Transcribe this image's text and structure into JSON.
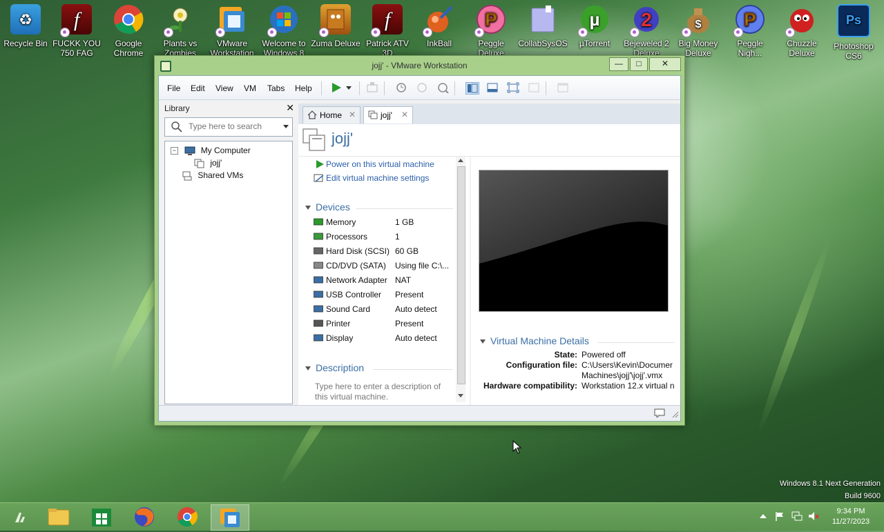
{
  "desktop": {
    "icons": [
      {
        "label": "Recycle Bin"
      },
      {
        "label": "FUCKK YOU 750 FAG"
      },
      {
        "label": "Google Chrome"
      },
      {
        "label": "Plants vs Zombies"
      },
      {
        "label": "VMware Workstation"
      },
      {
        "label": "Welcome to Windows 8"
      },
      {
        "label": "Zuma Deluxe"
      },
      {
        "label": "Patrick ATV 3D"
      },
      {
        "label": "InkBall"
      },
      {
        "label": "Peggle Deluxe"
      },
      {
        "label": "CollabSysOS"
      },
      {
        "label": "µTorrent"
      },
      {
        "label": "Bejeweled 2 Deluxe"
      },
      {
        "label": "Big Money Deluxe"
      },
      {
        "label": "Peggle Nigh..."
      },
      {
        "label": "Chuzzle Deluxe"
      },
      {
        "label": "Photoshop CS6"
      }
    ],
    "watermark_line1": "Windows 8.1 Next Generation",
    "watermark_line2": "Build 9600"
  },
  "window": {
    "title": "jojj' - VMware Workstation",
    "minimize": "—",
    "maximize": "□",
    "close": "✕"
  },
  "menu": {
    "file": "File",
    "edit": "Edit",
    "view": "View",
    "vm": "VM",
    "tabs": "Tabs",
    "help": "Help"
  },
  "library": {
    "title": "Library",
    "close": "✕",
    "search_placeholder": "Type here to search",
    "tree": {
      "my_computer": "My Computer",
      "vm": "jojj'",
      "shared": "Shared VMs"
    }
  },
  "tabs": [
    {
      "label": "Home",
      "close": "✕"
    },
    {
      "label": "jojj'",
      "close": "✕"
    }
  ],
  "vm": {
    "name": "jojj'",
    "actions": {
      "power_on": "Power on this virtual machine",
      "edit_settings": "Edit virtual machine settings"
    },
    "devices_title": "Devices",
    "devices": [
      {
        "name": "Memory",
        "value": "1 GB",
        "icon": "memory-icon"
      },
      {
        "name": "Processors",
        "value": "1",
        "icon": "processor-icon"
      },
      {
        "name": "Hard Disk (SCSI)",
        "value": "60 GB",
        "icon": "hard-disk-icon"
      },
      {
        "name": "CD/DVD (SATA)",
        "value": "Using file C:\\...",
        "icon": "cd-dvd-icon"
      },
      {
        "name": "Network Adapter",
        "value": "NAT",
        "icon": "network-adapter-icon"
      },
      {
        "name": "USB Controller",
        "value": "Present",
        "icon": "usb-icon"
      },
      {
        "name": "Sound Card",
        "value": "Auto detect",
        "icon": "sound-card-icon"
      },
      {
        "name": "Printer",
        "value": "Present",
        "icon": "printer-icon"
      },
      {
        "name": "Display",
        "value": "Auto detect",
        "icon": "display-icon"
      }
    ],
    "description_title": "Description",
    "description_placeholder_1": "Type here to enter a description of",
    "description_placeholder_2": "this virtual machine.",
    "details_title": "Virtual Machine Details",
    "details": {
      "state_label": "State:",
      "state_value": "Powered off",
      "config_label": "Configuration file:",
      "config_value_1": "C:\\Users\\Kevin\\Documer",
      "config_value_2": "Machines\\jojj'\\jojj'.vmx",
      "hw_label": "Hardware compatibility:",
      "hw_value": "Workstation 12.x virtual n"
    }
  },
  "taskbar": {
    "time": "9:34 PM",
    "date": "11/27/2023"
  },
  "colors": {
    "accent": "#3a6ea5",
    "link": "#2a5ea8",
    "window_frame": "#a8d08a",
    "taskbar": "#5b9450"
  }
}
